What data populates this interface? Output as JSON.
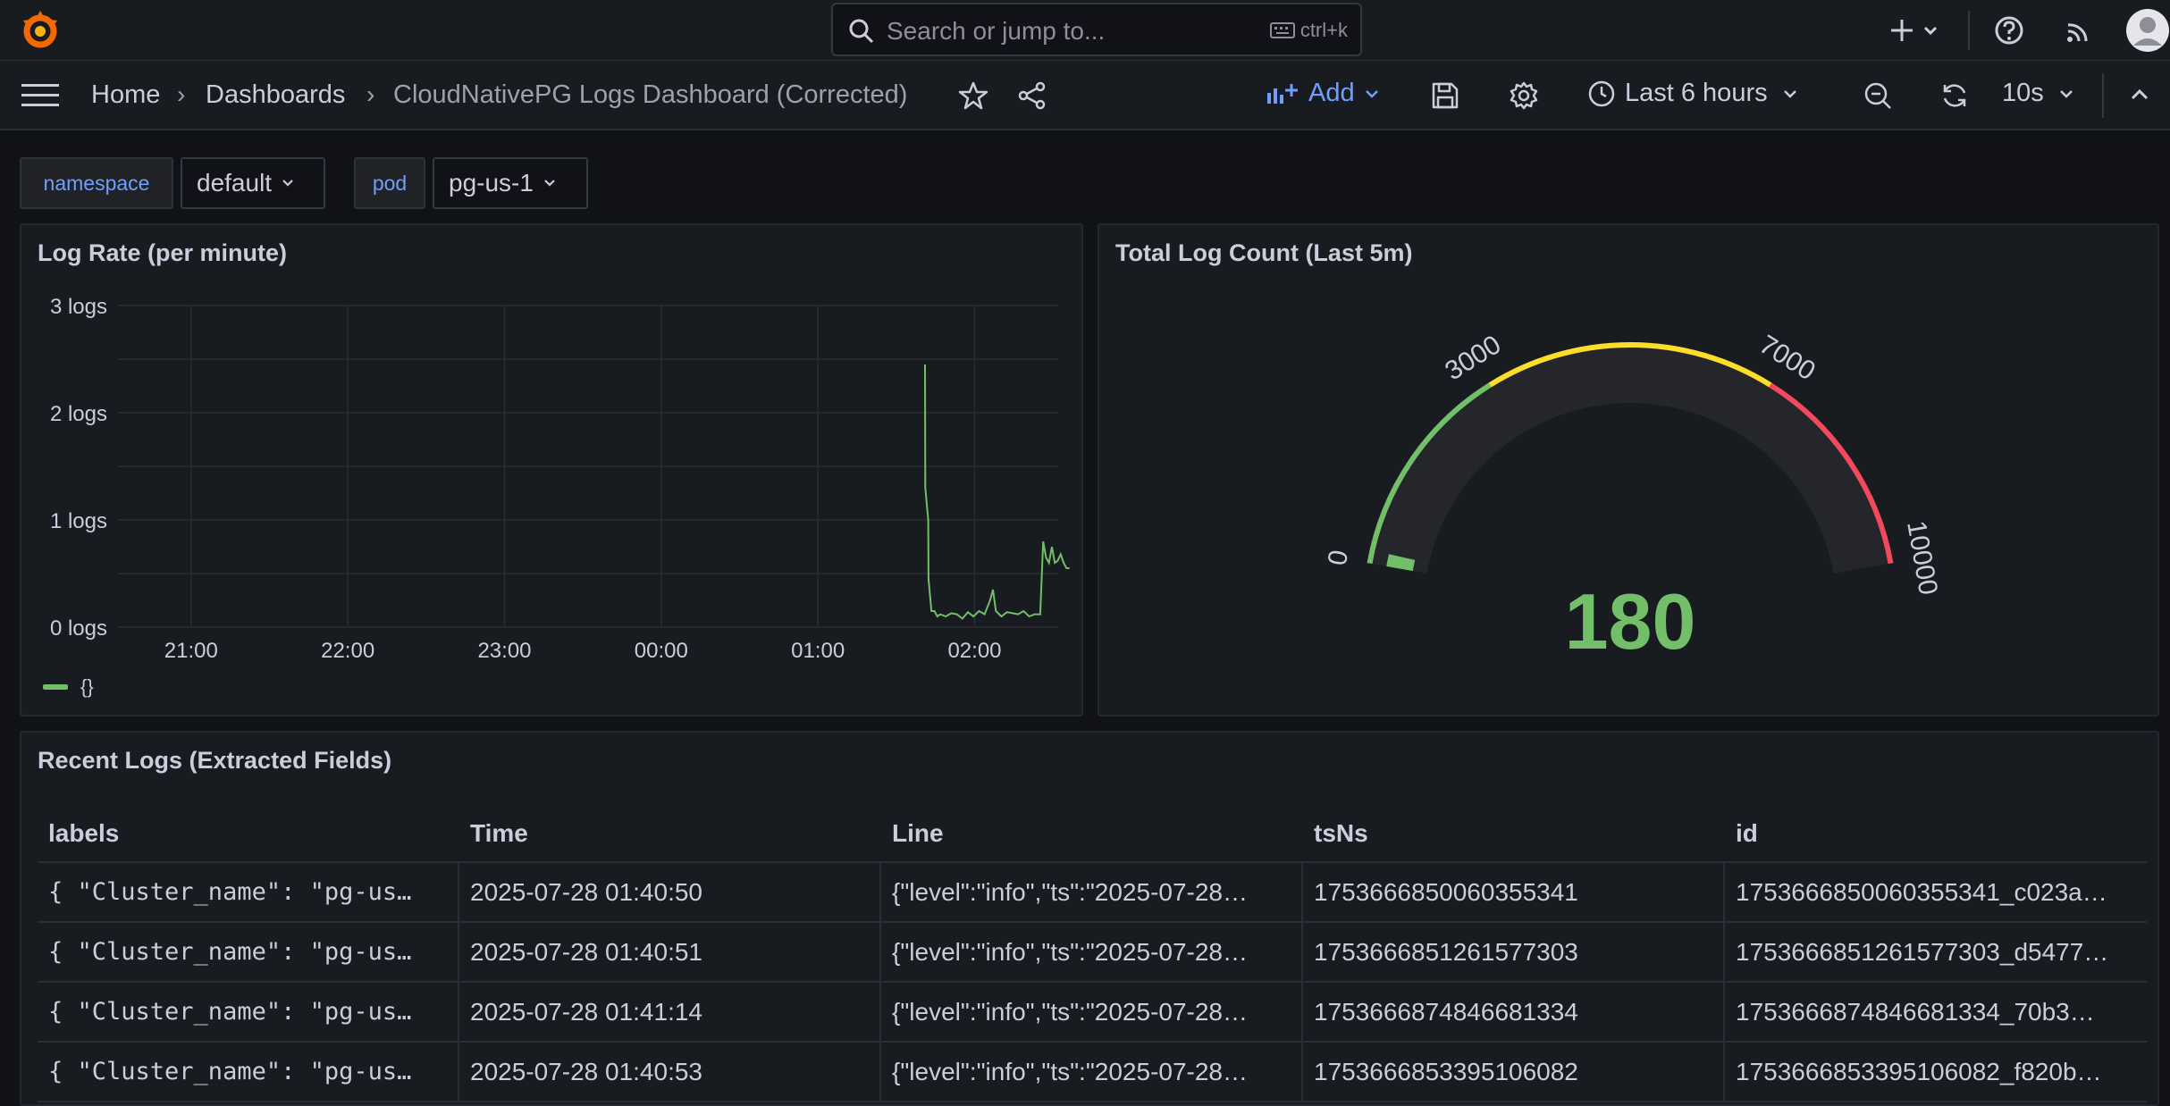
{
  "search": {
    "placeholder": "Search or jump to...",
    "shortcut": "ctrl+k"
  },
  "breadcrumb": {
    "home": "Home",
    "dashboards": "Dashboards",
    "current": "CloudNativePG Logs Dashboard (Corrected)"
  },
  "toolbar": {
    "add_label": "Add",
    "time_range": "Last 6 hours",
    "refresh_interval": "10s"
  },
  "variables": [
    {
      "label": "namespace",
      "value": "default"
    },
    {
      "label": "pod",
      "value": "pg-us-1"
    }
  ],
  "log_rate_panel": {
    "title": "Log Rate (per minute)"
  },
  "gauge_panel": {
    "title": "Total Log Count (Last 5m)"
  },
  "table_panel": {
    "title": "Recent Logs (Extracted Fields)",
    "columns": [
      "labels",
      "Time",
      "Line",
      "tsNs",
      "id"
    ],
    "rows": [
      [
        "{ \"Cluster_name\": \"pg-us…",
        "2025-07-28 01:40:50",
        "{\"level\":\"info\",\"ts\":\"2025-07-28…",
        "1753666850060355341",
        "1753666850060355341_c023a…"
      ],
      [
        "{ \"Cluster_name\": \"pg-us…",
        "2025-07-28 01:40:51",
        "{\"level\":\"info\",\"ts\":\"2025-07-28…",
        "1753666851261577303",
        "1753666851261577303_d5477…"
      ],
      [
        "{ \"Cluster_name\": \"pg-us…",
        "2025-07-28 01:41:14",
        "{\"level\":\"info\",\"ts\":\"2025-07-28…",
        "1753666874846681334",
        "1753666874846681334_70b3…"
      ],
      [
        "{ \"Cluster_name\": \"pg-us…",
        "2025-07-28 01:40:53",
        "{\"level\":\"info\",\"ts\":\"2025-07-28…",
        "1753666853395106082",
        "1753666853395106082_f820b…"
      ]
    ]
  },
  "colors": {
    "accent": "#6e9fff",
    "series": "#73bf69",
    "gauge_green": "#73bf69",
    "gauge_yellow": "#fade2a",
    "gauge_red": "#f2495c"
  },
  "chart_data": [
    {
      "type": "line",
      "title": "Log Rate (per minute)",
      "ylim": [
        0,
        3
      ],
      "y_ticks": [
        "0 logs",
        "1 logs",
        "2 logs",
        "3 logs"
      ],
      "x_ticks": [
        "21:00",
        "22:00",
        "23:00",
        "00:00",
        "01:00",
        "02:00"
      ],
      "grid": true,
      "legend_position": "bottom-left",
      "series": [
        {
          "name": "{}",
          "x": [
            "01:41",
            "01:41",
            "01:42",
            "01:42",
            "01:43",
            "01:44",
            "01:45",
            "01:46",
            "01:48",
            "01:50",
            "01:52",
            "01:54",
            "01:56",
            "01:58",
            "02:00",
            "02:02",
            "02:04",
            "02:05",
            "02:06",
            "02:08",
            "02:10",
            "02:12",
            "02:14",
            "02:16",
            "02:18",
            "02:20",
            "02:22",
            "02:23",
            "02:24",
            "02:25",
            "02:26",
            "02:27",
            "02:28",
            "02:29",
            "02:30",
            "02:31",
            "02:32"
          ],
          "values": [
            2.45,
            1.3,
            1.0,
            0.45,
            0.15,
            0.15,
            0.1,
            0.12,
            0.1,
            0.13,
            0.12,
            0.08,
            0.14,
            0.1,
            0.15,
            0.12,
            0.25,
            0.35,
            0.15,
            0.1,
            0.14,
            0.13,
            0.12,
            0.15,
            0.1,
            0.12,
            0.12,
            0.8,
            0.65,
            0.6,
            0.75,
            0.6,
            0.62,
            0.68,
            0.6,
            0.55,
            0.55
          ]
        }
      ]
    },
    {
      "type": "gauge",
      "title": "Total Log Count (Last 5m)",
      "value": 180,
      "min": 0,
      "max": 10000,
      "tick_labels": [
        "0",
        "3000",
        "7000",
        "10000"
      ],
      "thresholds": [
        {
          "from": 0,
          "to": 3000,
          "color": "#73bf69"
        },
        {
          "from": 3000,
          "to": 7000,
          "color": "#fade2a"
        },
        {
          "from": 7000,
          "to": 10000,
          "color": "#f2495c"
        }
      ]
    }
  ]
}
